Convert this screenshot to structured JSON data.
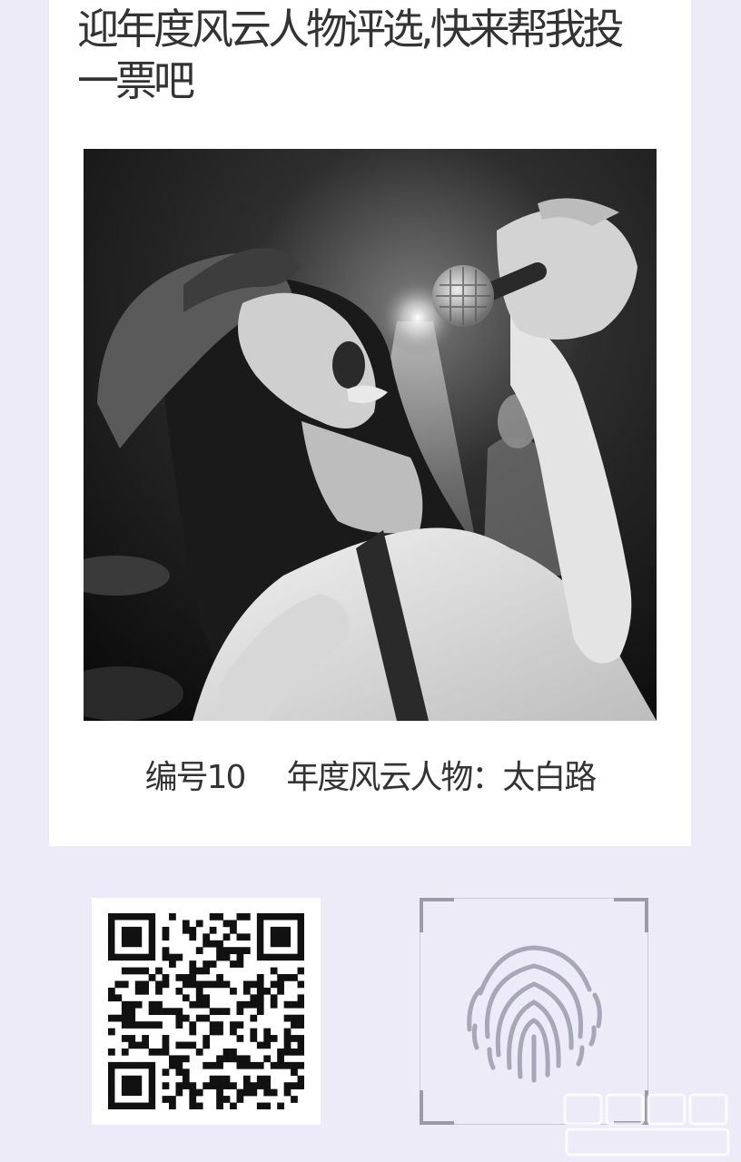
{
  "header": {
    "title": "迎年度风云人物评选,快来帮我投一票吧"
  },
  "photo": {
    "icon": "singer-photo"
  },
  "caption": {
    "number_label": "编号10",
    "award_label": "年度风云人物",
    "name": "：太白路"
  },
  "actions": {
    "qr_icon": "qr-code-icon",
    "fingerprint_icon": "fingerprint-icon"
  },
  "colors": {
    "background": "#ecebf7",
    "card": "#ffffff",
    "text": "#333333",
    "fingerprint": "#a7a7b8"
  }
}
